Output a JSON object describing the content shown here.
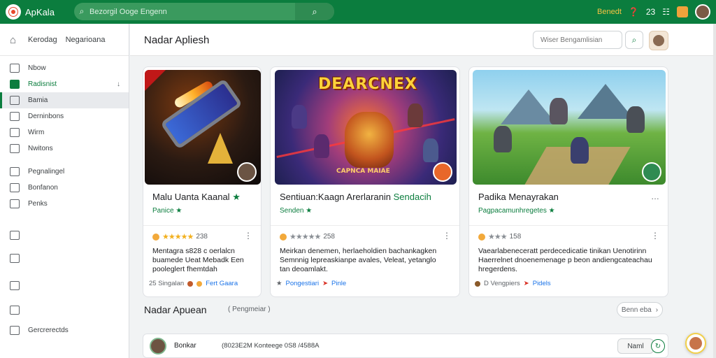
{
  "app": {
    "name": "ApKala"
  },
  "topbar": {
    "search_placeholder": "Bezorgil Ooge Engenn",
    "link": "Benedt",
    "badge": "23"
  },
  "sidebar": {
    "header": [
      "Kerodag",
      "Negarioana"
    ],
    "items": [
      {
        "label": "Nbow"
      },
      {
        "label": "Radisnist"
      },
      {
        "label": "Bamia"
      },
      {
        "label": "Derninbons"
      },
      {
        "label": "Wirm"
      },
      {
        "label": "Nwitons"
      },
      {
        "label": "Pegnalingel"
      },
      {
        "label": "Bonfanon"
      },
      {
        "label": "Penks"
      },
      {
        "label": "Gercrerectds"
      }
    ]
  },
  "main": {
    "title": "Nadar Apliesh",
    "search_placeholder": "Wiser Bengamlisian"
  },
  "cards": [
    {
      "title": "Malu Uanta Kaanal",
      "title_hl": "",
      "sub": "Panice",
      "rating_count": "238",
      "desc": "Mentagra s828 c oerlalcn buamede Ueat Mebadk Een pooleglert fhemtdah",
      "foot_left": "25 Singalan",
      "foot_link": "Fert Gaara",
      "badge_color": "#6b5444"
    },
    {
      "title": "Sentiuan:Kaagn Arerlaranin ",
      "title_hl": "Sendacih",
      "sub": "Senden",
      "rating_count": "258",
      "desc": "Meirkan denemen, herlaeholdien bachankagken Semnnig lepreaskianpe avales, Veleat, yetanglo tan deoamlakt.",
      "foot_left": "Pongestiari",
      "foot_link": "Pinle",
      "art_title": "DEARCNEX",
      "art_bottom": "CAPNCA MAIAE",
      "badge_color": "#e8672a"
    },
    {
      "title": "Padika Menayrakan",
      "title_hl": "",
      "sub": "Pagpacamunhregetes",
      "rating_count": "158",
      "desc": "Vaearlabeneceratt perdecedicatie tinikan Uenotirinn Haerrelnet dnoenemenage p beon andiengcateachau hregerdens.",
      "foot_left": "D Vengpiers",
      "foot_link": "Pidels",
      "badge_color": "#2f8b52"
    }
  ],
  "section2": {
    "title": "Nadar Apuean",
    "sub": "Pengmeiar",
    "button": "Benn eba",
    "row": {
      "name": "Bonkar",
      "meta": "(8023E2M Konteege 0S8 /4588A",
      "button": "Naml"
    }
  },
  "colors": {
    "brand": "#0b7d3e",
    "accent": "#f6c343",
    "link": "#1a73e8"
  }
}
